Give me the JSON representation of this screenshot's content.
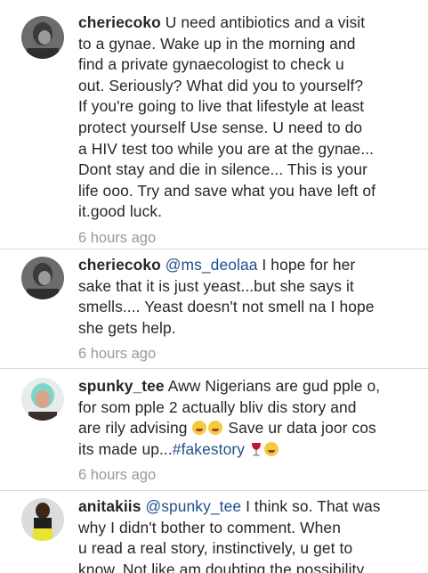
{
  "comments": [
    {
      "username": "cheriecoko",
      "lines": [
        "U need antibiotics and a visit",
        "to a gynae. Wake up in the morning and",
        "find a private gynaecologist  to check u",
        "out. Seriously? What did you to yourself?",
        "If you're going to live that lifestyle at least",
        "protect yourself Use sense. U need to do",
        "a HIV test too while you are at the gynae...",
        "Dont stay and die in silence... This is your",
        "life ooo. Try and save what you have left of",
        "it.good luck."
      ],
      "time": "6 hours ago"
    },
    {
      "username": "cheriecoko",
      "mention": "@ms_deolaa",
      "line1_rest": " I hope for her",
      "lines": [
        "sake that it is just yeast...but she says it",
        "smells.... Yeast doesn't not smell na I hope",
        "she gets help."
      ],
      "time": "6 hours ago"
    },
    {
      "username": "spunky_tee",
      "line1_rest": "Aww Nigerians are gud pple o,",
      "line2": "for som pple 2 actually bliv dis  story and",
      "line3": "are rily advising",
      "line3_after_emoji": " Save ur data joor cos",
      "line4": "its made up...",
      "hashtag": "#fakestory",
      "time": "6 hours ago"
    },
    {
      "username": "anitakiis",
      "mention": "@spunky_tee",
      "line1_rest": " I think so. That was",
      "lines": [
        "why I didn't bother to comment. When",
        "u read a real story, instinctively, u get to",
        "know. Not like am doubting the possibility"
      ]
    }
  ],
  "icons": [
    "grinning-sweat-emoji",
    "wine-glass-emoji"
  ]
}
